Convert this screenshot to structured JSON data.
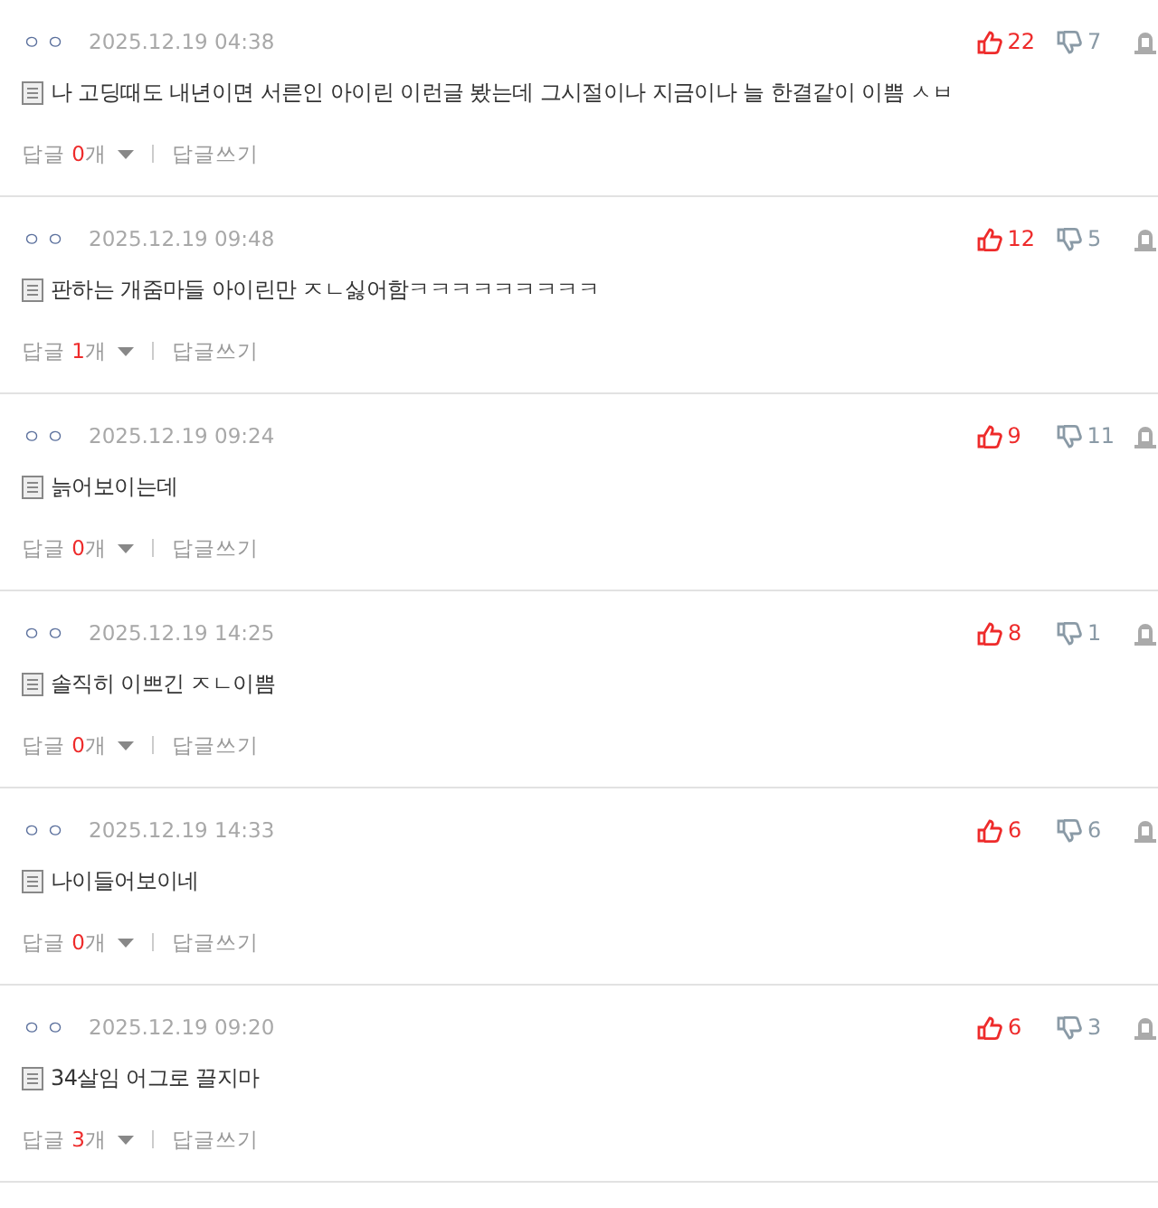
{
  "comments": [
    {
      "author": "ㅇㅇ",
      "date": "2025.12.19 04:38",
      "likes": "22",
      "dislikes": "7",
      "text": "나 고딩때도 내년이면 서른인 아이린 이런글 봤는데 그시절이나 지금이나 늘 한결같이 이쁨 ㅅㅂ",
      "reply_label": "답글",
      "reply_count": "0",
      "reply_unit": "개",
      "write_reply": "답글쓰기"
    },
    {
      "author": "ㅇㅇ",
      "date": "2025.12.19 09:48",
      "likes": "12",
      "dislikes": "5",
      "text": "판하는 개줌마들 아이린만 ㅈㄴ싫어함ㅋㅋㅋㅋㅋㅋㅋㅋㅋ",
      "reply_label": "답글",
      "reply_count": "1",
      "reply_unit": "개",
      "write_reply": "답글쓰기"
    },
    {
      "author": "ㅇㅇ",
      "date": "2025.12.19 09:24",
      "likes": "9",
      "dislikes": "11",
      "text": "늙어보이는데",
      "reply_label": "답글",
      "reply_count": "0",
      "reply_unit": "개",
      "write_reply": "답글쓰기"
    },
    {
      "author": "ㅇㅇ",
      "date": "2025.12.19 14:25",
      "likes": "8",
      "dislikes": "1",
      "text": "솔직히 이쁘긴 ㅈㄴ이쁨",
      "reply_label": "답글",
      "reply_count": "0",
      "reply_unit": "개",
      "write_reply": "답글쓰기"
    },
    {
      "author": "ㅇㅇ",
      "date": "2025.12.19 14:33",
      "likes": "6",
      "dislikes": "6",
      "text": "나이들어보이네",
      "reply_label": "답글",
      "reply_count": "0",
      "reply_unit": "개",
      "write_reply": "답글쓰기"
    },
    {
      "author": "ㅇㅇ",
      "date": "2025.12.19 09:20",
      "likes": "6",
      "dislikes": "3",
      "text": "34살임 어그로 끌지마",
      "reply_label": "답글",
      "reply_count": "3",
      "reply_unit": "개",
      "write_reply": "답글쓰기"
    }
  ]
}
